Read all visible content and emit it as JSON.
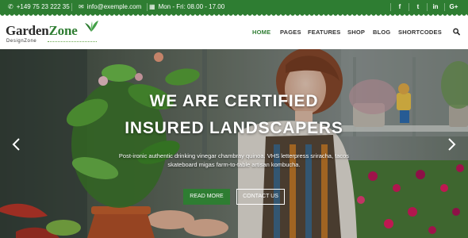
{
  "topbar": {
    "phone": "+149 75 23 222 35",
    "email": "info@exemple.com",
    "hours": "Mon - Fri: 08.00 - 17.00",
    "social": [
      "f",
      "t",
      "in",
      "G+"
    ]
  },
  "logo": {
    "name_part1": "Garden",
    "name_part2": "Zone",
    "tagline": "DesignZone"
  },
  "nav": {
    "items": [
      "HOME",
      "PAGES",
      "FEATURES",
      "SHOP",
      "BLOG",
      "SHORTCODES"
    ],
    "active": "HOME"
  },
  "hero": {
    "title_line1": "WE ARE CERTIFIED",
    "title_line2": "INSURED LANDSCAPERS",
    "text_line1": "Post-ironic authentic drinking vinegar chambray quinoa. VHS letterpress sriracha, tacos",
    "text_line2": "skateboard migas farm-to-table artisan kombucha.",
    "primary_button": "READ MORE",
    "secondary_button": "CONTACT US"
  },
  "colors": {
    "brand_green": "#2e7d32",
    "nav_text": "#333333",
    "white": "#ffffff"
  },
  "icons": {
    "phone": "phone-icon",
    "email": "envelope-icon",
    "hours": "calendar-icon",
    "search": "search-icon",
    "prev": "chevron-left-icon",
    "next": "chevron-right-icon"
  }
}
